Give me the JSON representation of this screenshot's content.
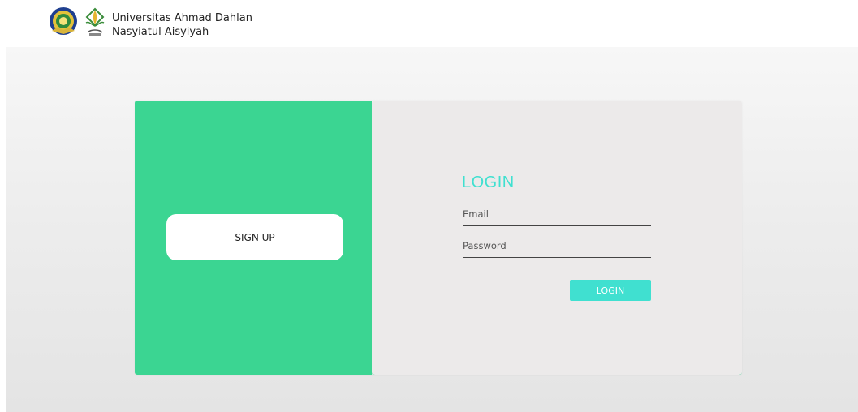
{
  "header": {
    "logo_uad_icon": "uad-seal-logo-icon",
    "logo_nasyiah_icon": "nasyiatul-aisyiyah-logo-icon",
    "brand_line1": "Universitas Ahmad Dahlan",
    "brand_line2": "Nasyiatul Aisyiyah"
  },
  "left_panel": {
    "signup_label": "SIGN UP"
  },
  "login_form": {
    "title": "LOGIN",
    "email_placeholder": "Email",
    "password_placeholder": "Password",
    "submit_label": "LOGIN"
  },
  "colors": {
    "green_panel": "#3bd592",
    "accent_cyan": "#40e0d0",
    "form_panel": "#eceaea"
  }
}
